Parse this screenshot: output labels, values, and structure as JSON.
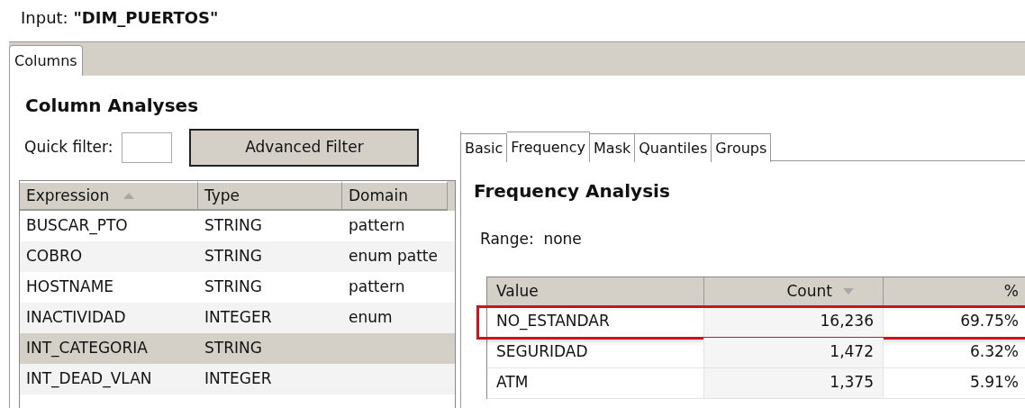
{
  "input_label": "Input: **\"DIM_PUERTOS\"**",
  "outer_tabs": [
    {
      "label": "Columns",
      "selected": true
    }
  ],
  "left": {
    "title": "Column Analyses",
    "quick_filter": {
      "label": "Quick filter:"
    },
    "advanced_button": "Advanced Filter",
    "columns": [
      {
        "label": "Expression",
        "kind": "ascending"
      },
      {
        "label": "Type",
        "kind": "plain"
      },
      {
        "label": "Domain",
        "kind": "plain"
      }
    ],
    "rows": [
      {
        "cells": [
          "BUSCAR_PTO",
          "STRING",
          "pattern"
        ],
        "selected": false
      },
      {
        "cells": [
          "COBRO",
          "STRING",
          "enum patte"
        ],
        "selected": false
      },
      {
        "cells": [
          "HOSTNAME",
          "STRING",
          "pattern"
        ],
        "selected": false
      },
      {
        "cells": [
          "INACTIVIDAD",
          "INTEGER",
          "enum"
        ],
        "selected": false
      },
      {
        "cells": [
          "INT_CATEGORIA",
          "STRING",
          ""
        ],
        "selected": true
      },
      {
        "cells": [
          "INT_DEAD_VLAN",
          "INTEGER",
          ""
        ],
        "selected": false
      }
    ]
  },
  "right": {
    "tabs": [
      {
        "label": "Basic",
        "selected": false
      },
      {
        "label": "Frequency",
        "selected": true
      },
      {
        "label": "Mask",
        "selected": false
      },
      {
        "label": "Quantiles",
        "selected": false
      },
      {
        "label": "Groups",
        "selected": false
      }
    ],
    "title": "Frequency Analysis",
    "range": "Range:  none",
    "columns": [
      {
        "label": "Value",
        "kind": "plain"
      },
      {
        "label": "Count",
        "kind": "descending"
      },
      {
        "label": "%",
        "kind": "plain"
      }
    ],
    "rows": [
      {
        "cells": [
          "NO_ESTANDAR",
          "16,236",
          "69.75%"
        ],
        "highlighted": true
      },
      {
        "cells": [
          "SEGURIDAD",
          "1,472",
          "6.32%"
        ],
        "highlighted": false
      },
      {
        "cells": [
          "ATM",
          "1,375",
          "5.91%"
        ],
        "highlighted": false
      }
    ]
  }
}
